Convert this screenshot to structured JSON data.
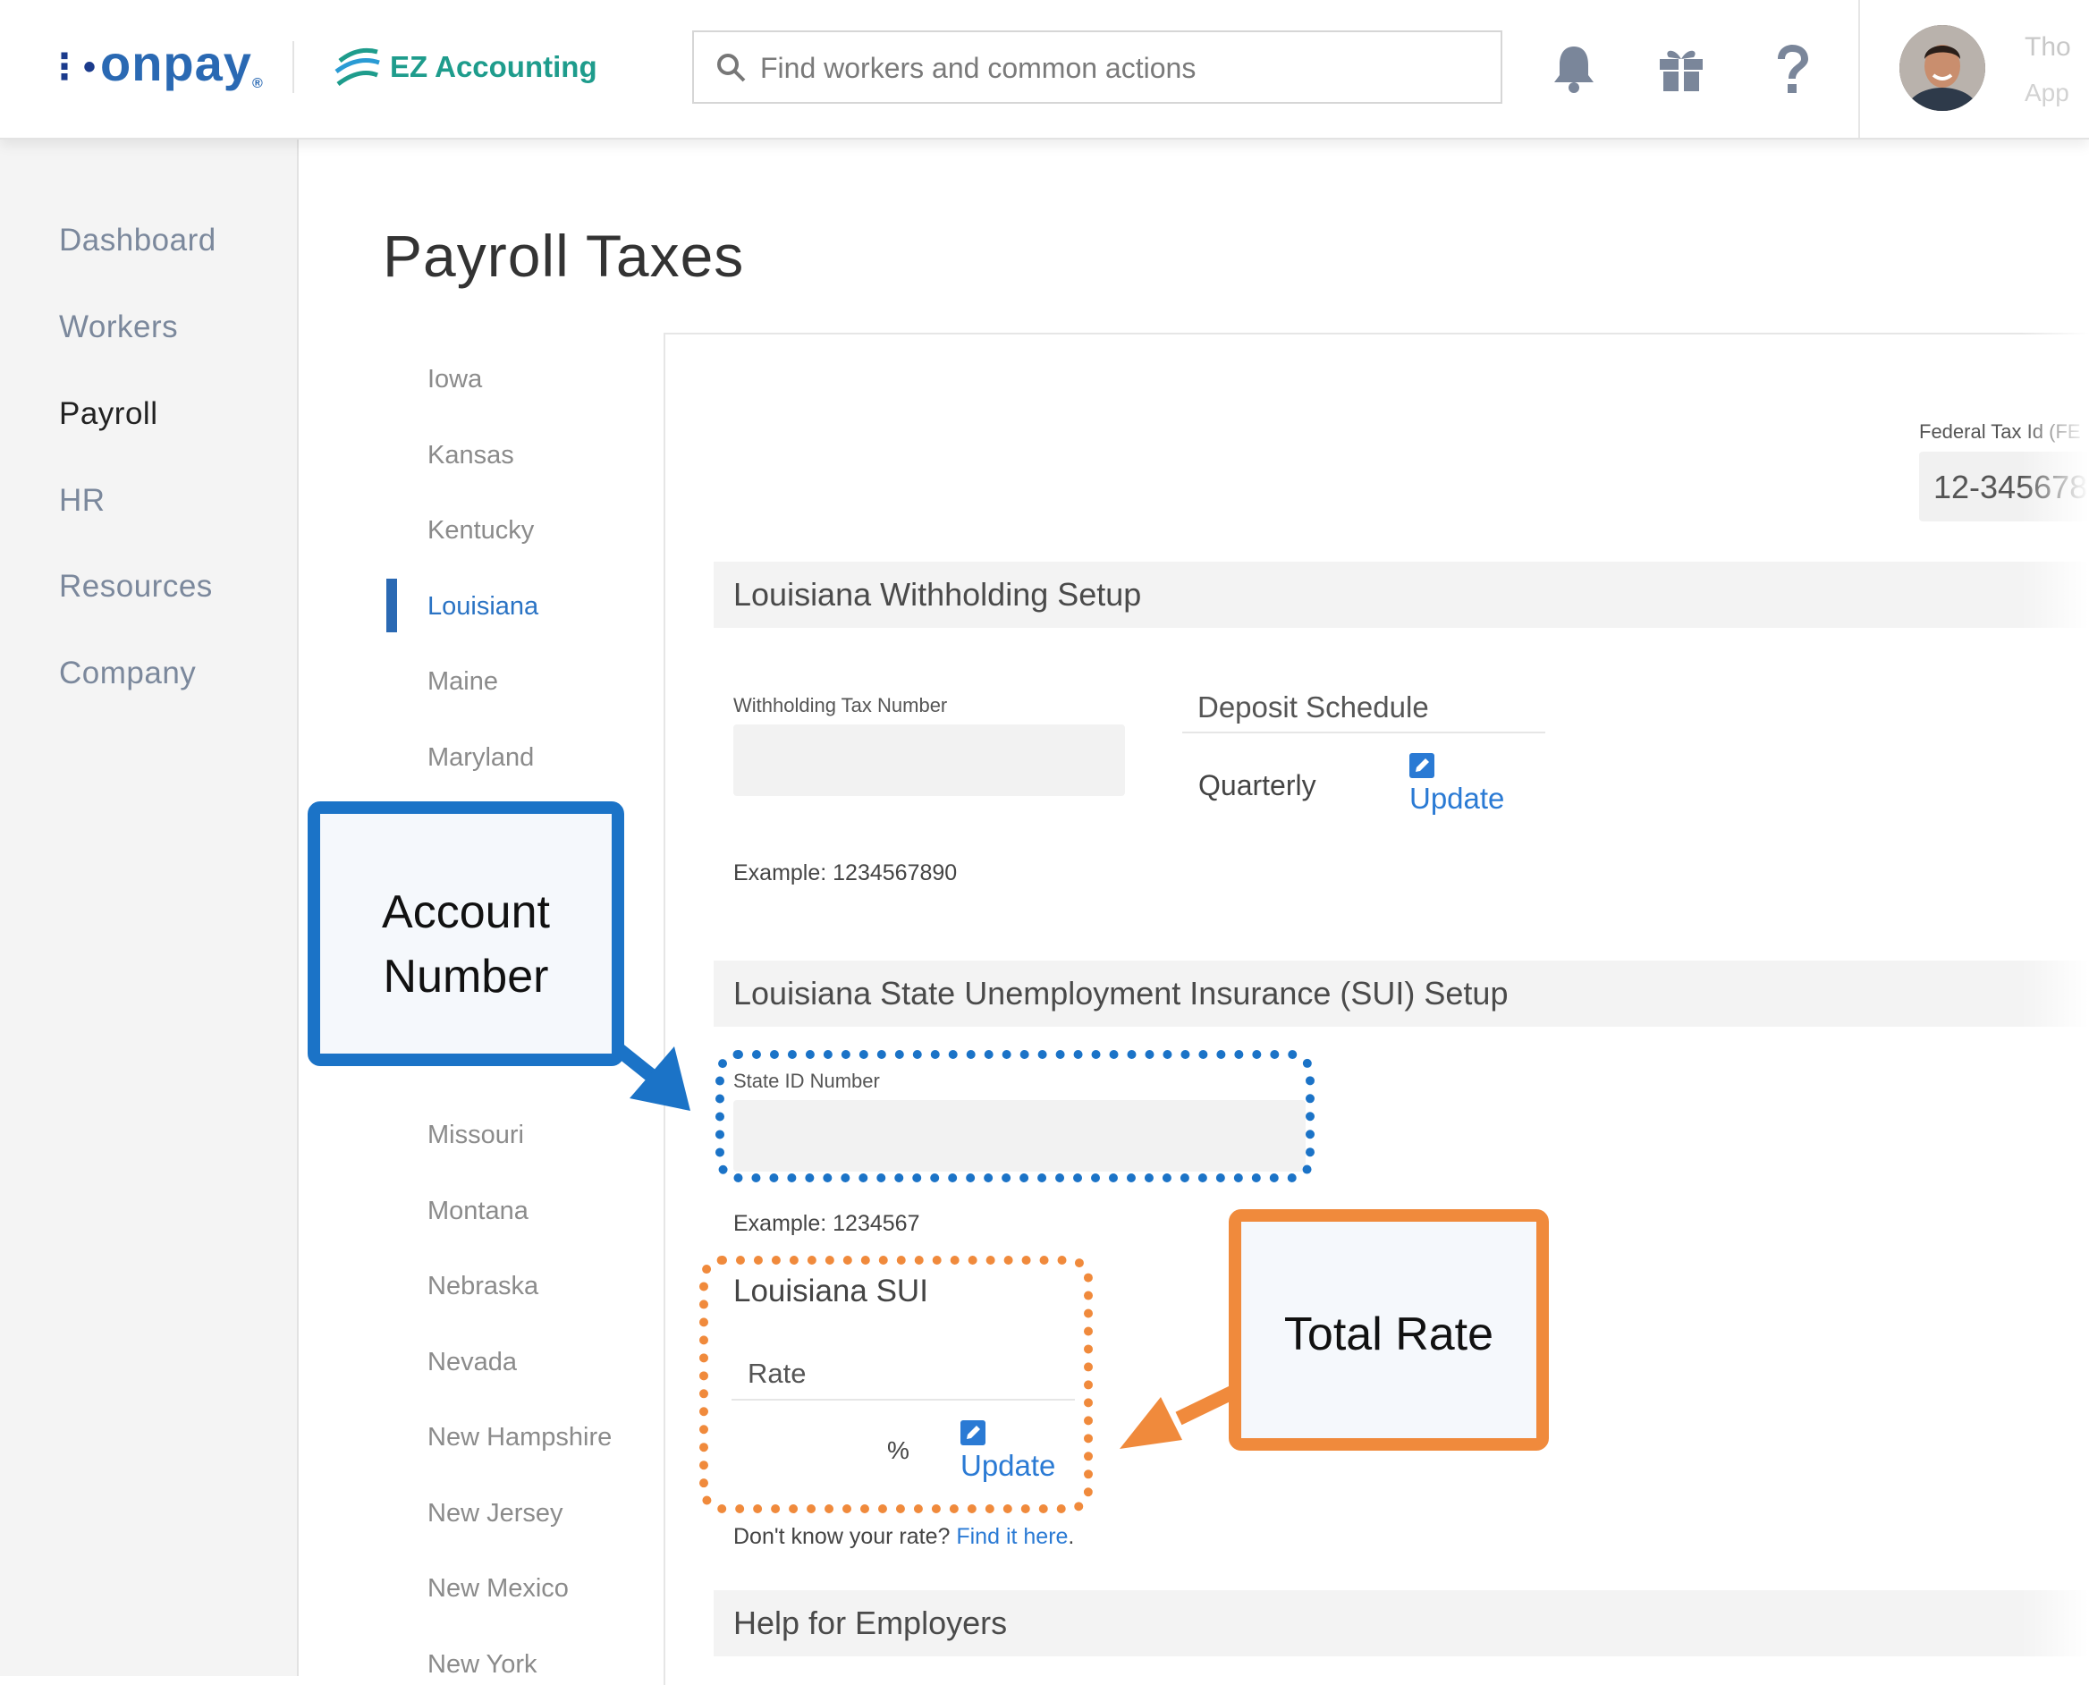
{
  "header": {
    "brand": "onpay",
    "partner": "EZ Accounting",
    "search_placeholder": "Find workers and common actions",
    "user_name": "Tho",
    "user_role": "App"
  },
  "sidebar": {
    "items": [
      {
        "label": "Dashboard",
        "active": false
      },
      {
        "label": "Workers",
        "active": false
      },
      {
        "label": "Payroll",
        "active": true
      },
      {
        "label": "HR",
        "active": false
      },
      {
        "label": "Resources",
        "active": false
      },
      {
        "label": "Company",
        "active": false
      }
    ]
  },
  "page": {
    "title": "Payroll Taxes"
  },
  "states": {
    "items": [
      "Iowa",
      "Kansas",
      "Kentucky",
      "Louisiana",
      "Maine",
      "Maryland",
      "Missouri",
      "Montana",
      "Nebraska",
      "Nevada",
      "New Hampshire",
      "New Jersey",
      "New Mexico",
      "New York"
    ],
    "selected": "Louisiana"
  },
  "federal": {
    "label": "Federal Tax Id (FE",
    "value": "12-345678"
  },
  "withholding": {
    "section_title": "Louisiana Withholding Setup",
    "tax_number_label": "Withholding Tax Number",
    "tax_number_value": "",
    "example": "Example: 1234567890",
    "deposit_title": "Deposit Schedule",
    "deposit_value": "Quarterly",
    "update_label": "Update"
  },
  "sui": {
    "section_title": "Louisiana State Unemployment Insurance (SUI) Setup",
    "state_id_label": "State ID Number",
    "state_id_value": "",
    "example": "Example: 1234567",
    "box_title": "Louisiana SUI",
    "rate_label": "Rate",
    "rate_unit": "%",
    "update_label": "Update",
    "dont_know": "Don't know your rate?",
    "find_link": "Find it here",
    "find_suffix": "."
  },
  "help": {
    "section_title": "Help for Employers"
  },
  "callouts": {
    "account": [
      "Account",
      "Number"
    ],
    "total_rate": "Total Rate",
    "blue": "#1b73c7",
    "orange": "#f08a3c"
  },
  "colors": {
    "brand_blue": "#2a69b3",
    "link_blue": "#2a7ad4",
    "ez_teal": "#1e9c8c"
  }
}
